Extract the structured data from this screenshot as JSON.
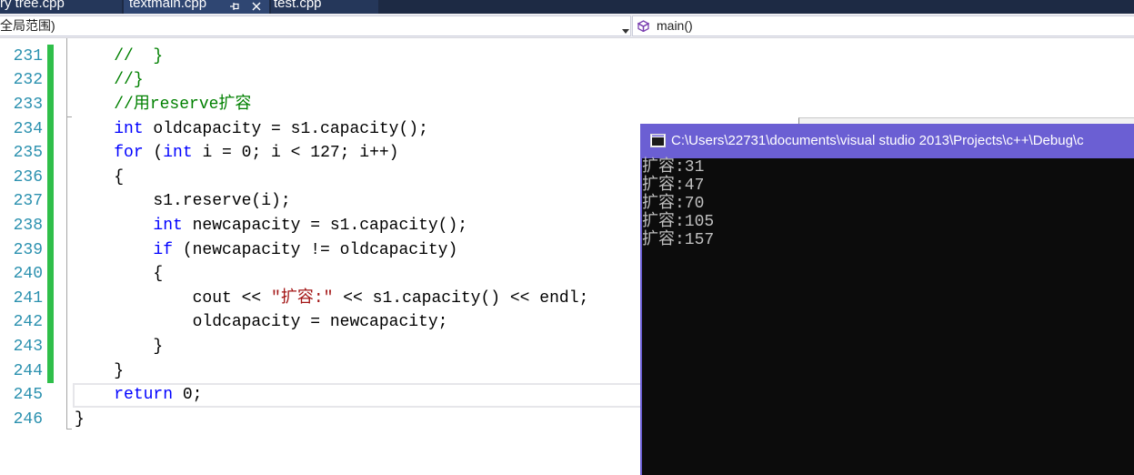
{
  "tabs": [
    {
      "label": "ry tree.cpp",
      "active": false
    },
    {
      "label": "textmain.cpp",
      "active": true,
      "icons": [
        "pin-icon",
        "close-icon"
      ]
    },
    {
      "label": "test.cpp",
      "active": false
    }
  ],
  "nav": {
    "scope": "全局范围)",
    "member": "main()",
    "member_icon": "method-icon"
  },
  "editor": {
    "current_line": 245,
    "lines": [
      {
        "number": 231,
        "changed": true,
        "tokens": [
          {
            "type": "plain",
            "text": "    "
          },
          {
            "type": "comment",
            "text": "//  }"
          }
        ]
      },
      {
        "number": 232,
        "changed": true,
        "tokens": [
          {
            "type": "plain",
            "text": "    "
          },
          {
            "type": "comment",
            "text": "//}"
          }
        ]
      },
      {
        "number": 233,
        "changed": true,
        "tokens": [
          {
            "type": "plain",
            "text": "    "
          },
          {
            "type": "comment",
            "text": "//用reserve扩容"
          }
        ]
      },
      {
        "number": 234,
        "changed": true,
        "tokens": [
          {
            "type": "plain",
            "text": "    "
          },
          {
            "type": "keyword",
            "text": "int"
          },
          {
            "type": "plain",
            "text": " oldcapacity = s1.capacity();"
          }
        ]
      },
      {
        "number": 235,
        "changed": true,
        "tokens": [
          {
            "type": "plain",
            "text": "    "
          },
          {
            "type": "keyword",
            "text": "for"
          },
          {
            "type": "plain",
            "text": " ("
          },
          {
            "type": "keyword",
            "text": "int"
          },
          {
            "type": "plain",
            "text": " i = 0; i < 127; i++)"
          }
        ]
      },
      {
        "number": 236,
        "changed": true,
        "tokens": [
          {
            "type": "plain",
            "text": "    {"
          }
        ]
      },
      {
        "number": 237,
        "changed": true,
        "tokens": [
          {
            "type": "plain",
            "text": "        s1.reserve(i);"
          }
        ]
      },
      {
        "number": 238,
        "changed": true,
        "tokens": [
          {
            "type": "plain",
            "text": "        "
          },
          {
            "type": "keyword",
            "text": "int"
          },
          {
            "type": "plain",
            "text": " newcapacity = s1.capacity();"
          }
        ]
      },
      {
        "number": 239,
        "changed": true,
        "tokens": [
          {
            "type": "plain",
            "text": "        "
          },
          {
            "type": "keyword",
            "text": "if"
          },
          {
            "type": "plain",
            "text": " (newcapacity != oldcapacity)"
          }
        ]
      },
      {
        "number": 240,
        "changed": true,
        "tokens": [
          {
            "type": "plain",
            "text": "        {"
          }
        ]
      },
      {
        "number": 241,
        "changed": true,
        "tokens": [
          {
            "type": "plain",
            "text": "            cout << "
          },
          {
            "type": "string",
            "text": "\"扩容:\""
          },
          {
            "type": "plain",
            "text": " << s1.capacity() << endl;"
          }
        ]
      },
      {
        "number": 242,
        "changed": true,
        "tokens": [
          {
            "type": "plain",
            "text": "            oldcapacity = newcapacity;"
          }
        ]
      },
      {
        "number": 243,
        "changed": true,
        "tokens": [
          {
            "type": "plain",
            "text": "        }"
          }
        ]
      },
      {
        "number": 244,
        "changed": true,
        "tokens": [
          {
            "type": "plain",
            "text": "    }"
          }
        ]
      },
      {
        "number": 245,
        "changed": false,
        "tokens": [
          {
            "type": "plain",
            "text": "    "
          },
          {
            "type": "keyword",
            "text": "return"
          },
          {
            "type": "plain",
            "text": " 0;"
          }
        ]
      },
      {
        "number": 246,
        "changed": false,
        "tokens": [
          {
            "type": "plain",
            "text": "}"
          }
        ]
      }
    ]
  },
  "console": {
    "title": "C:\\Users\\22731\\documents\\visual studio 2013\\Projects\\c++\\Debug\\c",
    "icon": "console-app-icon",
    "output": [
      "扩容:31",
      "扩容:47",
      "扩容:70",
      "扩容:105",
      "扩容:157"
    ]
  },
  "colors": {
    "keyword": "#0000ff",
    "comment": "#008000",
    "string": "#a31515",
    "plain": "#000000",
    "line_number": "#2b91af",
    "change_bar": "#2fbf4a",
    "tab_bar": "#1d2a44",
    "console_title_bar": "#6b5fd3",
    "console_bg": "#0c0c0c",
    "console_text": "#c0c0c0",
    "method_icon": "#7a3fb0"
  }
}
